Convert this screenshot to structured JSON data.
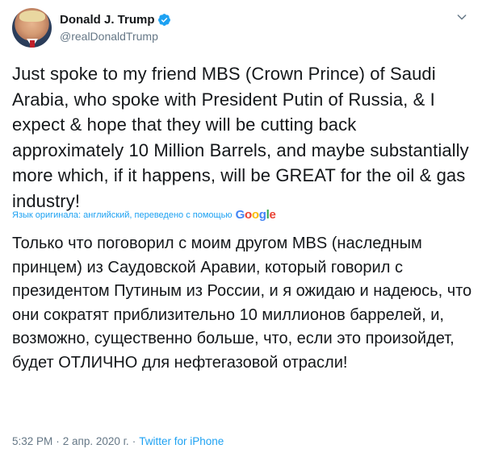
{
  "author": {
    "display_name": "Donald J. Trump",
    "handle": "@realDonaldTrump",
    "verified": true
  },
  "tweet": {
    "text_original": "Just spoke to my friend MBS (Crown Prince) of Saudi Arabia, who spoke with President Putin of Russia, & I expect & hope that they will be cutting back approximately 10 Million Barrels, and maybe substantially more which, if it happens, will be GREAT for the oil & gas industry!",
    "translation_note": "Язык оригинала: английский, переведено с помощью",
    "translation_provider": "Google",
    "text_translated": "Только что поговорил с моим другом MBS (наследным принцем) из Саудовской Аравии, который говорил с президентом Путиным из России, и я ожидаю и надеюсь, что они сократят приблизительно 10 миллионов баррелей, и, возможно, существенно больше, что, если это произойдет, будет ОТЛИЧНО для нефтегазовой отрасли!",
    "time": "5:32 PM",
    "date": "2 апр. 2020 г.",
    "separator": "·",
    "source": "Twitter for iPhone"
  },
  "colors": {
    "text": "#14171a",
    "secondary": "#657786",
    "accent": "#1da1f2"
  },
  "icons": {
    "verified": "verified-badge-icon",
    "menu": "chevron-down-icon"
  }
}
